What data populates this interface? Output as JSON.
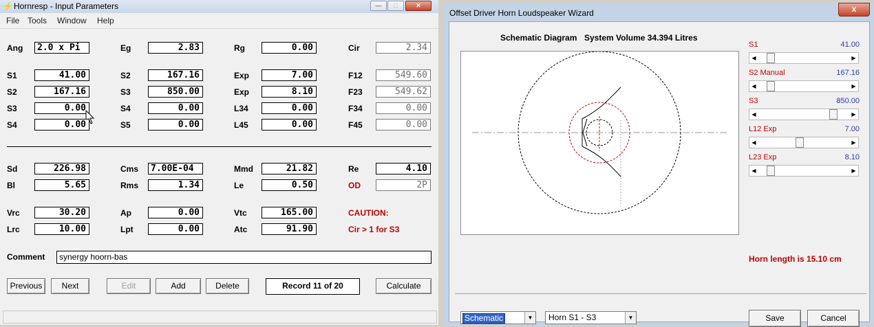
{
  "left_window": {
    "title": "Hornresp - Input Parameters",
    "menu": [
      "File",
      "Tools",
      "Window",
      "Help"
    ],
    "params": {
      "ang": {
        "label": "Ang",
        "value": "2.0 x Pi"
      },
      "eg": {
        "label": "Eg",
        "value": "2.83"
      },
      "rg": {
        "label": "Rg",
        "value": "0.00"
      },
      "cir": {
        "label": "Cir",
        "value": "2.34"
      },
      "s1": {
        "label": "S1",
        "value": "41.00"
      },
      "s2a": {
        "label": "S2",
        "value": "167.16"
      },
      "exp1": {
        "label": "Exp",
        "value": "7.00"
      },
      "f12": {
        "label": "F12",
        "value": "549.60"
      },
      "s2": {
        "label": "S2",
        "value": "167.16"
      },
      "s3a": {
        "label": "S3",
        "value": "850.00"
      },
      "exp2": {
        "label": "Exp",
        "value": "8.10"
      },
      "f23": {
        "label": "F23",
        "value": "549.62"
      },
      "s3": {
        "label": "S3",
        "value": "0.00"
      },
      "s4a": {
        "label": "S4",
        "value": "0.00"
      },
      "l34": {
        "label": "L34",
        "value": "0.00"
      },
      "f34": {
        "label": "F34",
        "value": "0.00"
      },
      "s4": {
        "label": "S4",
        "value": "0.00"
      },
      "s5": {
        "label": "S5",
        "value": "0.00"
      },
      "l45": {
        "label": "L45",
        "value": "0.00"
      },
      "f45": {
        "label": "F45",
        "value": "0.00"
      },
      "sd": {
        "label": "Sd",
        "value": "226.98"
      },
      "cms": {
        "label": "Cms",
        "value": "7.00E-04"
      },
      "mmd": {
        "label": "Mmd",
        "value": "21.82"
      },
      "re": {
        "label": "Re",
        "value": "4.10"
      },
      "bl": {
        "label": "Bl",
        "value": "5.65"
      },
      "rms": {
        "label": "Rms",
        "value": "1.34"
      },
      "le": {
        "label": "Le",
        "value": "0.50"
      },
      "od": {
        "label": "OD",
        "value": "2P"
      },
      "vrc": {
        "label": "Vrc",
        "value": "30.20"
      },
      "ap": {
        "label": "Ap",
        "value": "0.00"
      },
      "vtc": {
        "label": "Vtc",
        "value": "165.00"
      },
      "lrc": {
        "label": "Lrc",
        "value": "10.00"
      },
      "lpt": {
        "label": "Lpt",
        "value": "0.00"
      },
      "atc": {
        "label": "Atc",
        "value": "91.90"
      }
    },
    "caution": "CAUTION:",
    "caution_detail": "Cir > 1 for S3",
    "comment_label": "Comment",
    "comment_value": "synergy hoorn-bas",
    "buttons": {
      "previous": "Previous",
      "next": "Next",
      "edit": "Edit",
      "add": "Add",
      "delete": "Delete",
      "record": "Record 11 of 20",
      "calculate": "Calculate"
    }
  },
  "right_window": {
    "title": "Offset Driver Horn Loudspeaker Wizard",
    "close": "x",
    "schematic_title": "Schematic Diagram",
    "system_volume": "System Volume 34.394 Litres",
    "sliders": [
      {
        "label": "S1",
        "value": "41.00",
        "position": 0.1
      },
      {
        "label": "S2  Manual",
        "value": "167.16",
        "position": 0.1
      },
      {
        "label": "S3",
        "value": "850.00",
        "position": 0.86
      },
      {
        "label": "L12  Exp",
        "value": "7.00",
        "position": 0.45
      },
      {
        "label": "L23  Exp",
        "value": "8.10",
        "position": 0.1
      }
    ],
    "horn_length": "Horn length is 15.10 cm",
    "view_combo": "Schematic",
    "horn_combo": "Horn S1 - S3",
    "save": "Save",
    "cancel": "Cancel"
  }
}
